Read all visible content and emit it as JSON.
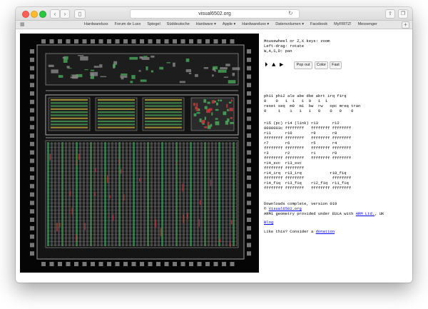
{
  "browser": {
    "url": "visual6502.org",
    "favorites": [
      "Hardwareluxx",
      "Forum de Luxx",
      "Spiegel",
      "Süddeutsche",
      "Hardware ▾",
      "Apple ▾",
      "Hardwareluxx ▾",
      "Datenvolumen ▾",
      "Facebook",
      "MyFRITZ!",
      "Messenger"
    ]
  },
  "help": {
    "line1": "Mousewheel or Z,X keys: zoom",
    "line2": "Left-drag: rotate",
    "line3": "W,A,S,D: pan"
  },
  "controls": {
    "pop_out": "Pop out",
    "color": "Color",
    "fast": "Fast"
  },
  "signals": {
    "row1_head": "phi1 phi2 ale abe dbe abrt irq firq",
    "row1_vals": "0    0   1  1   1  0   1  1",
    "row2_head": "reset seq  m0  m1  bw  rw   opc mreq tran",
    "row2_vals": "0     1    1   1   1   0    0   0    0"
  },
  "registers": [
    "r15 (pc) r14 (link) r13      r12",
    "0000003c ffffffff   ffffffff ffffffff",
    "r11      r10        r9       r8",
    "ffffffff ffffffff   ffffffff ffffffff",
    "r7       r6         r5       r4",
    "ffffffff ffffffff   ffffffff ffffffff",
    "r3       r2         r1       r0",
    "ffffffff ffffffff   ffffffff ffffffff",
    "r14_svc  r13_svc",
    "ffffffff ffffffff",
    "r14_irq  r13_irq            r10_fiq",
    "ffffffff ffffffff            ffffffff",
    "r14_fiq  r13_fiq    r12_fiq  r11_fiq",
    "ffffffff ffffffff   ffffffff ffffffff"
  ],
  "footer": {
    "download": "Downloads complete, version 019",
    "copyright_prefix": "© ",
    "copyright_link": "Visual6502.org",
    "geometry_prefix": "ARM1 geometry provided under EULA with ",
    "geometry_link": "ARM Ltd.",
    "geometry_suffix": ", UK",
    "blog": "Blog",
    "consider_prefix": "Like this? Consider a ",
    "donation": "donation"
  },
  "colors": {
    "chip_background": "#050505",
    "metal": "#9a9a9a",
    "green": "#4aa85a",
    "red": "#c23a3a",
    "yellow": "#c9b23a",
    "link": "#0000ee"
  }
}
